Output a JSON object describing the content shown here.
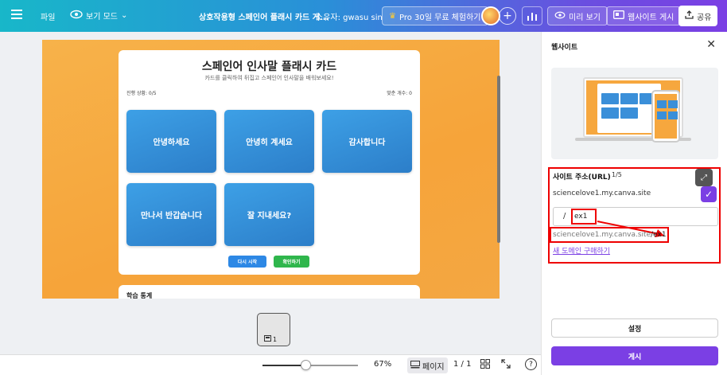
{
  "topbar": {
    "file_label": "파일",
    "view_mode_label": "보기 모드",
    "doc_title": "상호작용형 스페인어 플래시 카드 게...",
    "owner": "소유자: gwasu sin",
    "pro_trial": "Pro 30일 무료 체험하기",
    "preview_label": "미리 보기",
    "publish_site_label": "웹사이트 게시",
    "share_label": "공유"
  },
  "design": {
    "title": "스페인어 인사말 플래시 카드",
    "subtitle": "카드를 클릭하여 뒤집고 스페인어 인사말을 배워보세요!",
    "progress": "진행 상황: 0/5",
    "matched": "맞춘 개수: 0",
    "cards": [
      "안녕하세요",
      "안녕히 계세요",
      "감사합니다",
      "만나서 반갑습니다",
      "잘 지내세요?"
    ],
    "restart_label": "다시 시작",
    "check_label": "확인하기",
    "stats_title": "학습 통계"
  },
  "pages": {
    "thumb_label": "1"
  },
  "bottombar": {
    "zoom": "67%",
    "zoom_fraction": 0.45,
    "pages_label": "페이지",
    "page_count": "1 / 1",
    "help": "?"
  },
  "rpanel": {
    "title": "웹사이트",
    "url_label": "사이트 주소(URL)",
    "url_count": "1/5",
    "domain": "sciencelove1.my.canva.site",
    "path_slash": "/",
    "path_value": "ex1",
    "full_url_base": "sciencelove1.my.canva.site",
    "full_url_suffix": "/ex1",
    "buy_domain": "새 도메인 구매하기",
    "settings_label": "설정",
    "publish_label": "게시"
  },
  "colors": {
    "accent": "#7b3fe4",
    "card_blue": "#2c7ec9",
    "highlight": "#ee0000"
  }
}
